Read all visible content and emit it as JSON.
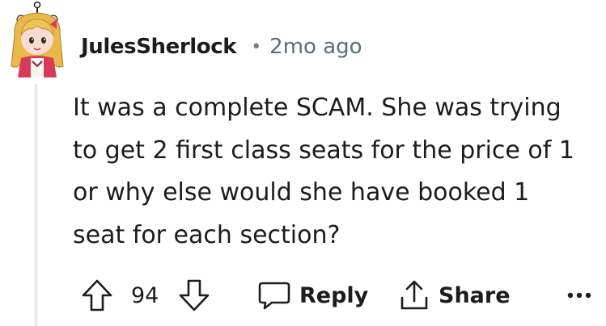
{
  "comment": {
    "author": "JulesSherlock",
    "separator": "•",
    "timestamp": "2mo ago",
    "body_lines": [
      "It was a complete SCAM. She was trying",
      "to get 2 first class seats for the price of 1",
      "or why else would she have booked 1",
      "seat for each section?"
    ]
  },
  "actions": {
    "upvote_icon": "arrow-up-icon",
    "score": "94",
    "downvote_icon": "arrow-down-icon",
    "reply_icon": "speech-bubble-icon",
    "reply_label": "Reply",
    "share_icon": "share-icon",
    "share_label": "Share",
    "more_icon": "ellipsis-icon"
  },
  "colors": {
    "text": "#1c1c1c",
    "meta": "#576f76",
    "thread_line": "#e6e8ea"
  }
}
